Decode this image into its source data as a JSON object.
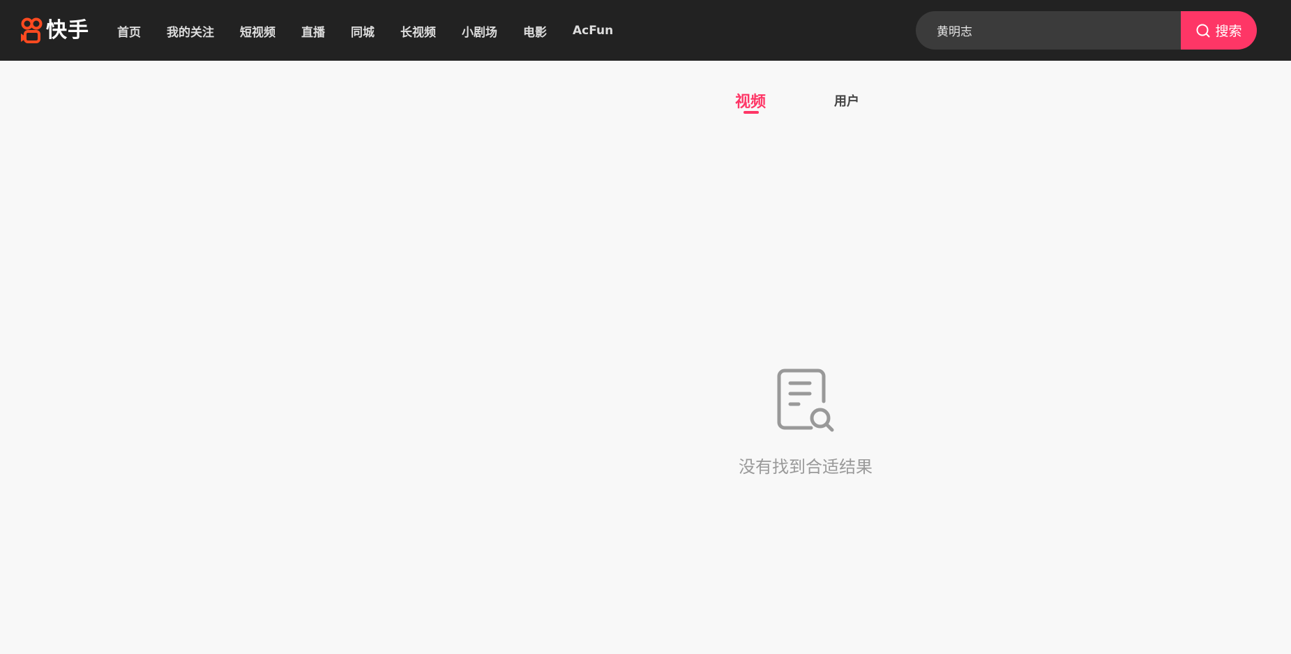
{
  "header": {
    "logo_text": "快手",
    "nav_items": [
      "首页",
      "我的关注",
      "短视频",
      "直播",
      "同城",
      "长视频",
      "小剧场",
      "电影",
      "AcFun"
    ],
    "search": {
      "value": "黄明志",
      "button_label": "搜索"
    }
  },
  "tabs": [
    {
      "label": "视频",
      "active": true
    },
    {
      "label": "用户",
      "active": false
    }
  ],
  "empty_state": {
    "icon": "document-search-icon",
    "message": "没有找到合适结果"
  },
  "colors": {
    "accent": "#fe3666",
    "header_bg": "#222222",
    "page_bg": "#f8f8f8",
    "logo": "#fe4a20"
  }
}
